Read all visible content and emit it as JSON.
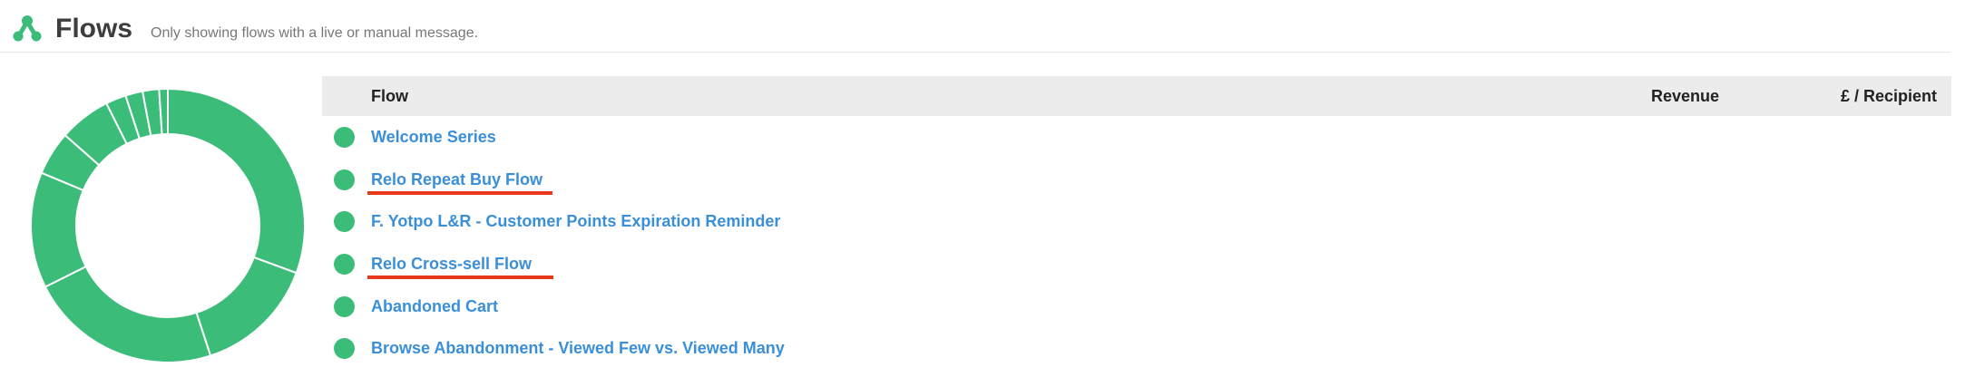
{
  "header": {
    "icon": "flows-icon",
    "title": "Flows",
    "subtitle": "Only showing flows with a live or manual message."
  },
  "colors": {
    "accent_green": "#3bbd79",
    "link_blue": "#3a8fd8",
    "annotation_red": "#e8391b",
    "table_header_bg": "#ececec"
  },
  "table": {
    "columns": {
      "flow": "Flow",
      "revenue": "Revenue",
      "per_recipient": "£ / Recipient"
    },
    "rows": [
      {
        "name": "Welcome Series",
        "status": "live",
        "annotated": false
      },
      {
        "name": "Relo Repeat Buy Flow",
        "status": "live",
        "annotated": true
      },
      {
        "name": "F. Yotpo L&R - Customer Points Expiration Reminder",
        "status": "live",
        "annotated": false
      },
      {
        "name": "Relo Cross-sell Flow",
        "status": "live",
        "annotated": true
      },
      {
        "name": "Abandoned Cart",
        "status": "live",
        "annotated": false
      },
      {
        "name": "Browse Abandonment - Viewed Few vs. Viewed Many",
        "status": "live",
        "annotated": false
      }
    ]
  },
  "chart_data": {
    "type": "pie",
    "variant": "donut",
    "slice_share_percent": [
      33.1,
      15.5,
      24.5,
      14.8,
      5.6,
      6.6,
      2.6,
      2.2,
      2.1,
      1.1
    ],
    "color": "#3bbd79"
  }
}
